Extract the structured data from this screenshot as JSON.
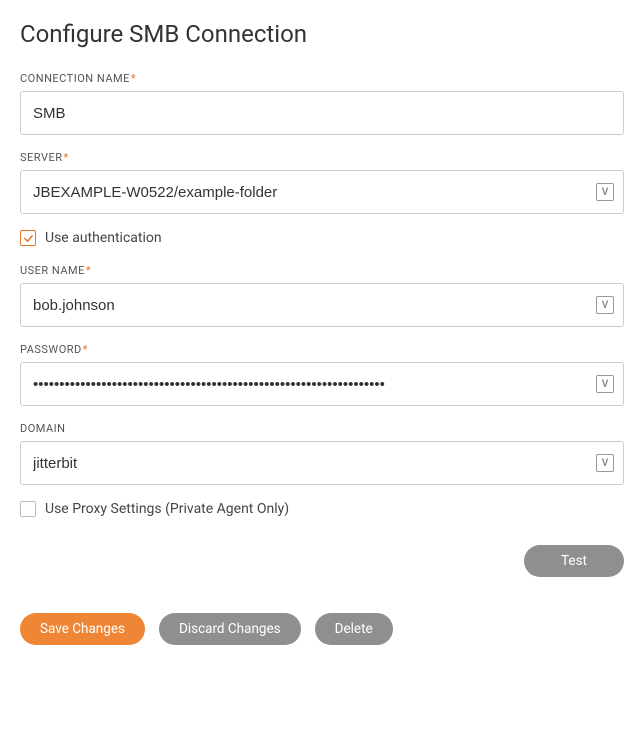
{
  "title": "Configure SMB Connection",
  "labels": {
    "connection_name": "CONNECTION NAME",
    "server": "SERVER",
    "user_name": "USER NAME",
    "password": "PASSWORD",
    "domain": "DOMAIN"
  },
  "values": {
    "connection_name": "SMB",
    "server": "JBEXAMPLE-W0522/example-folder",
    "user_name": "bob.johnson",
    "password": "•••••••••••••••••••••••••••••••••••••••••••••••••••••••••••••••••••",
    "domain": "jitterbit"
  },
  "checkboxes": {
    "use_authentication": "Use authentication",
    "use_proxy": "Use Proxy Settings (Private Agent Only)"
  },
  "buttons": {
    "test": "Test",
    "save": "Save Changes",
    "discard": "Discard Changes",
    "delete": "Delete"
  },
  "icons": {
    "variable": "V"
  }
}
